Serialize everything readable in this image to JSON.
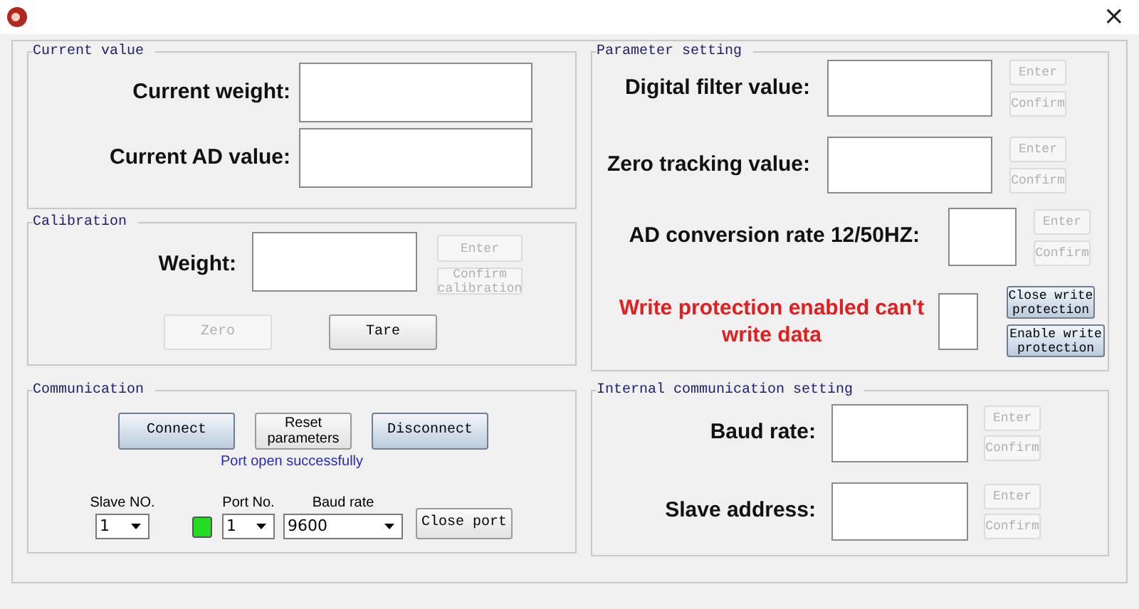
{
  "window": {
    "close": "×"
  },
  "current_value": {
    "title": "Current value",
    "fields": [
      {
        "label": "Current weight:"
      },
      {
        "label": "Current AD value:"
      }
    ]
  },
  "calibration": {
    "title": "Calibration",
    "label": "Weight:",
    "buttons": [
      {
        "label": "Enter",
        "disabled": true
      },
      {
        "label": "Confirm calibration",
        "disabled": true
      }
    ],
    "actions": [
      {
        "label": "Zero",
        "disabled": true
      },
      {
        "label": "Tare",
        "disabled": false
      }
    ]
  },
  "communication": {
    "title": "Communication",
    "buttons": [
      {
        "label": "Connect",
        "kind": "accent"
      },
      {
        "label": "Reset parameters",
        "kind": "plain"
      },
      {
        "label": "Disconnect",
        "kind": "accent"
      }
    ],
    "status": "Port open successfully",
    "slave_no": {
      "label": "Slave NO.",
      "value": "1"
    },
    "port_connected": true,
    "port_no": {
      "label": "Port No.",
      "value": "1"
    },
    "baud_rate": {
      "label": "Baud rate",
      "value": "9600"
    },
    "close_port": "Close port"
  },
  "parameter_setting": {
    "title": "Parameter setting",
    "rows": [
      {
        "label": "Digital filter value:",
        "buttons": [
          {
            "label": "Enter",
            "disabled": true
          },
          {
            "label": "Confirm",
            "disabled": true
          }
        ]
      },
      {
        "label": "Zero tracking value:",
        "buttons": [
          {
            "label": "Enter",
            "disabled": true
          },
          {
            "label": "Confirm",
            "disabled": true
          }
        ]
      },
      {
        "label": "AD conversion rate 12/50HZ:",
        "buttons": [
          {
            "label": "Enter",
            "disabled": true
          },
          {
            "label": "Confirm",
            "disabled": true
          }
        ]
      }
    ],
    "write_protection": {
      "message": "Write protection enabled can't write data",
      "buttons": [
        {
          "label": "Close write protection",
          "kind": "accent"
        },
        {
          "label": "Enable write protection",
          "kind": "accent"
        }
      ]
    }
  },
  "internal_communication": {
    "title": "Internal communication setting",
    "rows": [
      {
        "label": "Baud rate:",
        "buttons": [
          {
            "label": "Enter",
            "disabled": true
          },
          {
            "label": "Confirm",
            "disabled": true
          }
        ]
      },
      {
        "label": "Slave address:",
        "buttons": [
          {
            "label": "Enter",
            "disabled": true
          },
          {
            "label": "Confirm",
            "disabled": true
          }
        ]
      }
    ]
  }
}
